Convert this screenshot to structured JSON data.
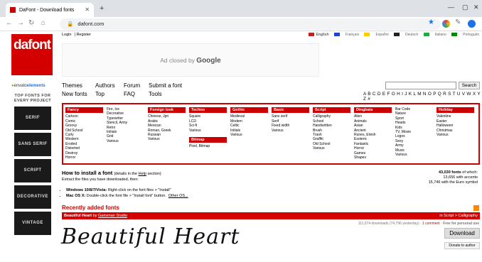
{
  "browser": {
    "tab_title": "DaFont - Download fonts",
    "url": "dafont.com"
  },
  "header": {
    "login": "Login",
    "register": "Register",
    "languages": [
      "English",
      "Français",
      "Español",
      "Deutsch",
      "Italiano",
      "Português"
    ]
  },
  "ad": {
    "text": "Ad closed by",
    "brand": "Google"
  },
  "nav": {
    "themes": "Themes",
    "authors": "Authors",
    "forum": "Forum",
    "submit": "Submit a font",
    "new_fonts": "New fonts",
    "top": "Top",
    "faq": "FAQ",
    "tools": "Tools"
  },
  "search": {
    "button": "Search"
  },
  "alphabet": "A B C D E F G H I J K L M N O P Q R S T U V W X Y Z #",
  "logo": {
    "line1": "dafont",
    ".com": ".com"
  },
  "left_ad": {
    "brand_a": "envato",
    "brand_b": "elements",
    "top_fonts": "TOP FONTS FOR EVERY PROJECT",
    "tiles": [
      "SERIF",
      "SANS SERIF",
      "SCRIPT",
      "DECORATIVE",
      "VINTAGE"
    ]
  },
  "categories": [
    {
      "title": "Fancy",
      "items": [
        "Cartoon",
        "Comic",
        "Groovy",
        "Old School",
        "Curly",
        "Western",
        "Eroded",
        "Distorted",
        "Destroy",
        "Horror"
      ]
    },
    {
      "title": "",
      "items": [
        "Fire, Ice",
        "Decorative",
        "Typewriter",
        "Stencil, Army",
        "Retro",
        "Initials",
        "Grid",
        "Various"
      ]
    },
    {
      "title": "Foreign look",
      "items": [
        "Chinese, Jpn",
        "Arabic",
        "Mexican",
        "Roman, Greek",
        "Russian",
        "Various"
      ]
    },
    {
      "title": "Techno",
      "items": [
        "Square",
        "LCD",
        "Sci-fi",
        "Various"
      ],
      "title2": "Bitmap",
      "items2": [
        "Pixel, Bitmap"
      ]
    },
    {
      "title": "Gothic",
      "items": [
        "Medieval",
        "Modern",
        "Celtic",
        "Initials",
        "Various"
      ]
    },
    {
      "title": "Basic",
      "items": [
        "Sans serif",
        "Serif",
        "Fixed width",
        "Various"
      ]
    },
    {
      "title": "Script",
      "items": [
        "Calligraphy",
        "School",
        "Handwritten",
        "Brush",
        "Trash",
        "Graffiti",
        "Old School",
        "Various"
      ]
    },
    {
      "title": "Dingbats",
      "items": [
        "Alien",
        "Animals",
        "Asian",
        "Ancient",
        "Runes, Elvish",
        "Esoteric",
        "Fantastic",
        "Horror",
        "Games",
        "Shapes"
      ]
    },
    {
      "title": "",
      "items": [
        "Bar Code",
        "Nature",
        "Sport",
        "Heads",
        "Kids",
        "TV, Movie",
        "Logos",
        "Sexy",
        "Army",
        "Music",
        "Various"
      ]
    },
    {
      "title": "Holiday",
      "items": [
        "Valentine",
        "Easter",
        "Halloween",
        "Christmas",
        "Various"
      ]
    }
  ],
  "install": {
    "title": "How to install a font",
    "subtitle_pre": "(details in the",
    "help": "Help",
    "subtitle_post": "section)",
    "extract": "Extract the files you have downloaded, then:",
    "win_label": "Windows 10/8/7/Vista:",
    "win_text": "Right-click on the font files > \"Install\"",
    "mac_label": "Mac OS X:",
    "mac_text": "Double-click the font file > \"Install font\" button.",
    "other": "Other OS..."
  },
  "stats": {
    "line1_num": "43,030 fonts",
    "line1_rest": "of which:",
    "line2": "13,656 with accents",
    "line3": "15,746 with the Euro symbol"
  },
  "recent": {
    "title": "Recently added fonts"
  },
  "featured": {
    "name": "Beautiful Heart",
    "by": "by",
    "author": "Garisman Studio",
    "category": "in Script > Calligraphy",
    "downloads": "111,574 downloads (74,796 yesterday)",
    "comment": "1 comment",
    "license": "Free for personal use",
    "download_btn": "Download",
    "donate_btn": "Donate to author",
    "preview": "Beautiful Heart"
  }
}
